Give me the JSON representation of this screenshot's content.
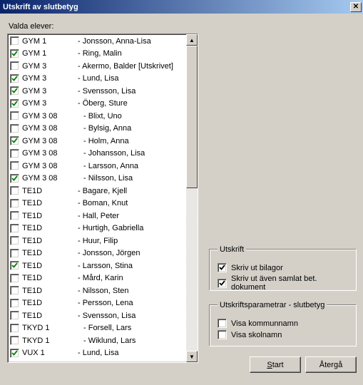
{
  "window": {
    "title": "Utskrift av slutbetyg"
  },
  "labels": {
    "selected_students": "Valda elever:",
    "group_print": "Utskrift",
    "group_params": "Utskriftsparametrar - slutbetyg",
    "print_attachments": "Skriv ut bilagor",
    "print_combined": "Skriv ut även samlat bet. dokument",
    "show_municipality": "Visa kommunnamn",
    "show_school": "Visa skolnamn"
  },
  "options": {
    "print_attachments": true,
    "print_combined": true,
    "show_municipality": false,
    "show_school": false
  },
  "buttons": {
    "start": "Start",
    "back": "Återgå"
  },
  "students": [
    {
      "checked": false,
      "class": "GYM 1",
      "name": "- Jonsson, Anna-Lisa",
      "indent": false
    },
    {
      "checked": true,
      "class": "GYM 1",
      "name": "- Ring, Malin",
      "indent": false
    },
    {
      "checked": false,
      "class": "GYM 3",
      "name": "- Akermo, Balder [Utskrivet]",
      "indent": false
    },
    {
      "checked": true,
      "class": "GYM 3",
      "name": "- Lund, Lisa",
      "indent": false
    },
    {
      "checked": true,
      "class": "GYM 3",
      "name": "- Svensson, Lisa",
      "indent": false
    },
    {
      "checked": true,
      "class": "GYM 3",
      "name": "- Öberg, Sture",
      "indent": false
    },
    {
      "checked": false,
      "class": "GYM 3 08",
      "name": "- Blixt, Uno",
      "indent": true
    },
    {
      "checked": false,
      "class": "GYM 3 08",
      "name": "- Bylsig, Anna",
      "indent": true
    },
    {
      "checked": true,
      "class": "GYM 3 08",
      "name": "- Holm, Anna",
      "indent": true
    },
    {
      "checked": false,
      "class": "GYM 3 08",
      "name": "- Johansson, Lisa",
      "indent": true
    },
    {
      "checked": false,
      "class": "GYM 3 08",
      "name": "- Larsson, Anna",
      "indent": true
    },
    {
      "checked": true,
      "class": "GYM 3 08",
      "name": "- Nilsson, Lisa",
      "indent": true
    },
    {
      "checked": false,
      "class": "TE1D",
      "name": "- Bagare, Kjell",
      "indent": false
    },
    {
      "checked": false,
      "class": "TE1D",
      "name": "- Boman, Knut",
      "indent": false
    },
    {
      "checked": false,
      "class": "TE1D",
      "name": "- Hall, Peter",
      "indent": false
    },
    {
      "checked": false,
      "class": "TE1D",
      "name": "- Hurtigh, Gabriella",
      "indent": false
    },
    {
      "checked": false,
      "class": "TE1D",
      "name": "- Huur, Filip",
      "indent": false
    },
    {
      "checked": false,
      "class": "TE1D",
      "name": "- Jonsson, Jörgen",
      "indent": false
    },
    {
      "checked": true,
      "class": "TE1D",
      "name": "- Larsson, Stina",
      "indent": false
    },
    {
      "checked": false,
      "class": "TE1D",
      "name": "- Mård, Karin",
      "indent": false
    },
    {
      "checked": false,
      "class": "TE1D",
      "name": "- Nilsson, Sten",
      "indent": false
    },
    {
      "checked": false,
      "class": "TE1D",
      "name": "- Persson, Lena",
      "indent": false
    },
    {
      "checked": false,
      "class": "TE1D",
      "name": "- Svensson, Lisa",
      "indent": false
    },
    {
      "checked": false,
      "class": "TKYD 1",
      "name": "- Forsell, Lars",
      "indent": true
    },
    {
      "checked": false,
      "class": "TKYD 1",
      "name": "- Wiklund, Lars",
      "indent": true
    },
    {
      "checked": true,
      "class": "VUX 1",
      "name": "- Lund, Lisa",
      "indent": false
    }
  ]
}
